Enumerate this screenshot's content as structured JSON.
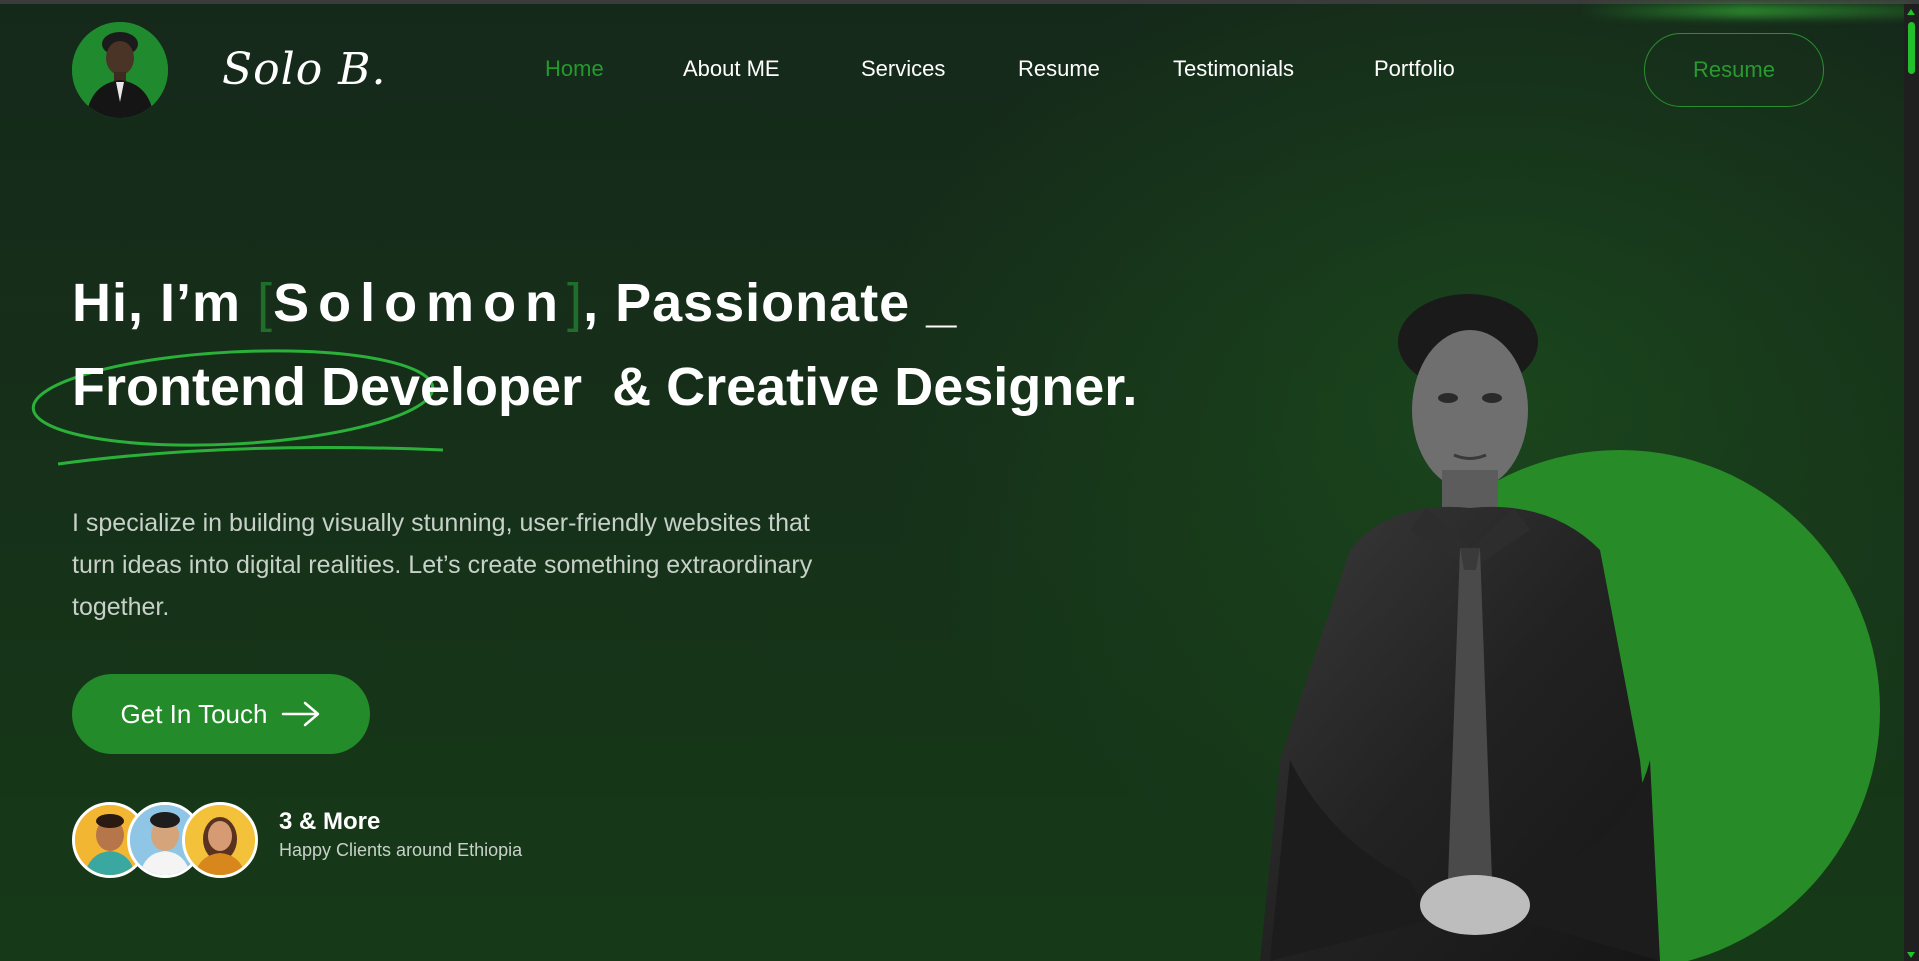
{
  "header": {
    "logo_text": "Solo B.",
    "nav": [
      {
        "label": "Home",
        "active": true
      },
      {
        "label": "About ME",
        "active": false
      },
      {
        "label": "Services",
        "active": false
      },
      {
        "label": "Resume",
        "active": false
      },
      {
        "label": "Testimonials",
        "active": false
      },
      {
        "label": "Portfolio",
        "active": false
      }
    ],
    "resume_button": "Resume"
  },
  "hero": {
    "greeting": "Hi, I’m",
    "bracket_open": "[",
    "name": "Solomon",
    "bracket_close": "]",
    "after_name": ", Passionate _",
    "role_highlight": "Frontend Developer",
    "role_rest": "& Creative Designer.",
    "description": "I specialize in building visually stunning, user-friendly websites that turn ideas into digital realities. Let’s create something extraordinary together.",
    "cta_label": "Get In Touch"
  },
  "clients": {
    "count": "3 & More",
    "label": "Happy Clients around Ethiopia"
  },
  "colors": {
    "accent": "#238b2a",
    "background": "#162b18",
    "nav_active": "#229a2c"
  },
  "icons": [
    "arrow-right-icon"
  ]
}
